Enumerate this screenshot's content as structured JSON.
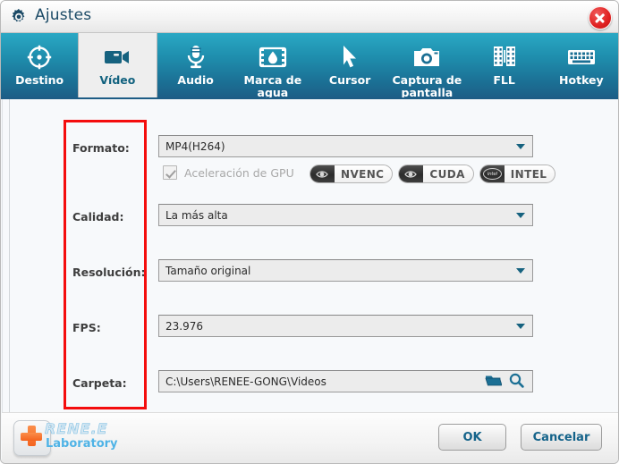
{
  "window": {
    "title": "Ajustes",
    "title_icon": "gear-icon",
    "close_icon": "close-icon",
    "accent_color": "#1b6f94",
    "highlight_color": "#f40d0d"
  },
  "tabs": [
    {
      "label": "Destino",
      "icon": "target-icon",
      "active": false
    },
    {
      "label": "Vídeo",
      "icon": "video-camera-icon",
      "active": true
    },
    {
      "label": "Audio",
      "icon": "microphone-icon",
      "active": false
    },
    {
      "label": "Marca de agua",
      "icon": "watermark-icon",
      "active": false
    },
    {
      "label": "Cursor",
      "icon": "cursor-arrow-icon",
      "active": false
    },
    {
      "label": "Captura de pantalla",
      "icon": "camera-icon",
      "active": false
    },
    {
      "label": "FLL",
      "icon": "film-strip-icon",
      "active": false
    },
    {
      "label": "Hotkey",
      "icon": "keyboard-icon",
      "active": false
    }
  ],
  "form": {
    "format": {
      "label": "Formato:",
      "value": "MP4(H264)"
    },
    "quality": {
      "label": "Calidad:",
      "value": "La más alta"
    },
    "resolution": {
      "label": "Resolución:",
      "value": "Tamaño original"
    },
    "fps": {
      "label": "FPS:",
      "value": "23.976"
    },
    "folder": {
      "label": "Carpeta:",
      "value": "C:\\Users\\RENEE-GONG\\Videos"
    }
  },
  "gpu": {
    "checkbox_label": "Aceleración de GPU",
    "checked": true,
    "badges": [
      {
        "name": "NVENC",
        "logo": "nvidia-eye-icon"
      },
      {
        "name": "CUDA",
        "logo": "nvidia-eye-icon"
      },
      {
        "name": "INTEL",
        "logo": "intel-oval-icon"
      }
    ]
  },
  "folder_actions": {
    "open_icon": "folder-icon",
    "browse_icon": "magnifier-icon"
  },
  "footer": {
    "logo_line1": "RENE.E",
    "logo_line2": "Laboratory",
    "ok_label": "OK",
    "cancel_label": "Cancelar"
  }
}
